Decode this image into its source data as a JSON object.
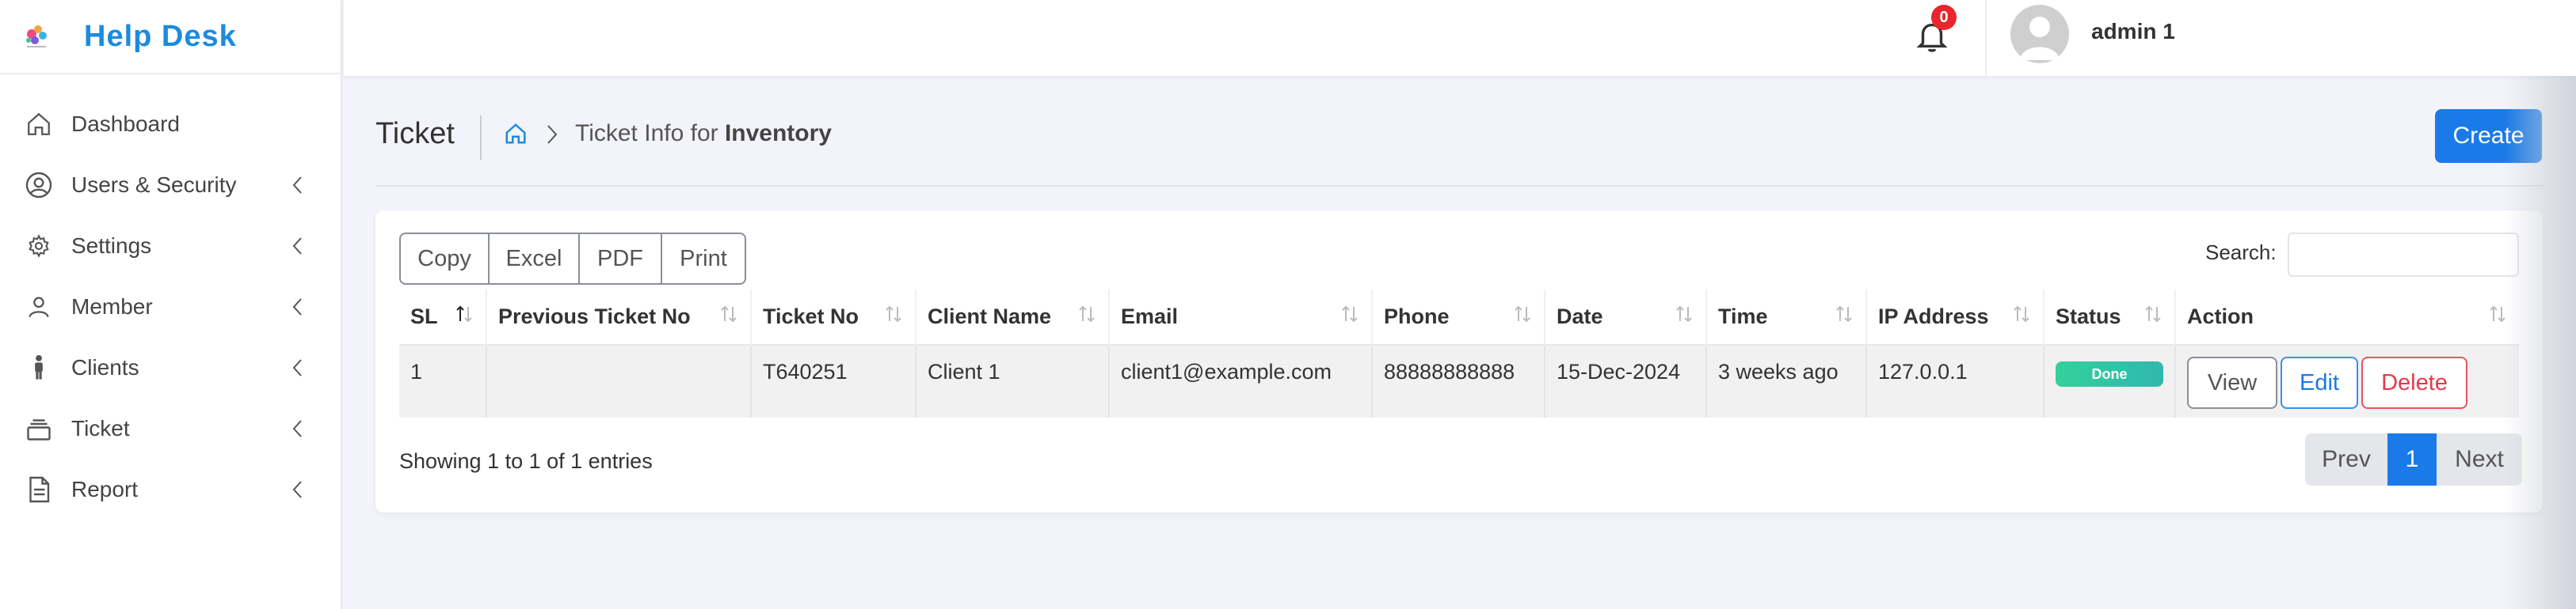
{
  "app": {
    "title": "Help Desk",
    "accent": "#1b8be0"
  },
  "sidebar": {
    "items": [
      {
        "label": "Dashboard",
        "icon": "home-icon",
        "has_chevron": false
      },
      {
        "label": "Users & Security",
        "icon": "user-circle-icon",
        "has_chevron": true
      },
      {
        "label": "Settings",
        "icon": "gear-icon",
        "has_chevron": true
      },
      {
        "label": "Member",
        "icon": "person-icon",
        "has_chevron": true
      },
      {
        "label": "Clients",
        "icon": "standing-person-icon",
        "has_chevron": true
      },
      {
        "label": "Ticket",
        "icon": "stack-icon",
        "has_chevron": true
      },
      {
        "label": "Report",
        "icon": "document-icon",
        "has_chevron": true
      }
    ]
  },
  "topbar": {
    "notifications": "0",
    "user_name": "admin 1"
  },
  "header": {
    "title": "Ticket",
    "breadcrumb_prefix": "Ticket Info for ",
    "breadcrumb_bold": "Inventory",
    "create_label": "Create"
  },
  "export_buttons": [
    "Copy",
    "Excel",
    "PDF",
    "Print"
  ],
  "search": {
    "label": "Search:",
    "value": ""
  },
  "table": {
    "columns": [
      "SL",
      "Previous Ticket No",
      "Ticket No",
      "Client Name",
      "Email",
      "Phone",
      "Date",
      "Time",
      "IP Address",
      "Status",
      "Action"
    ],
    "rows": [
      {
        "sl": "1",
        "previous_ticket_no": "",
        "ticket_no": "T640251",
        "client_name": "Client 1",
        "email": "client1@example.com",
        "phone": "88888888888",
        "date": "15-Dec-2024",
        "time": "3 weeks ago",
        "ip_address": "127.0.0.1",
        "status": "Done",
        "actions": {
          "view": "View",
          "edit": "Edit",
          "delete": "Delete"
        }
      }
    ]
  },
  "footer": {
    "info": "Showing 1 to 1 of 1 entries",
    "pagination": {
      "prev": "Prev",
      "current": "1",
      "next": "Next"
    }
  }
}
